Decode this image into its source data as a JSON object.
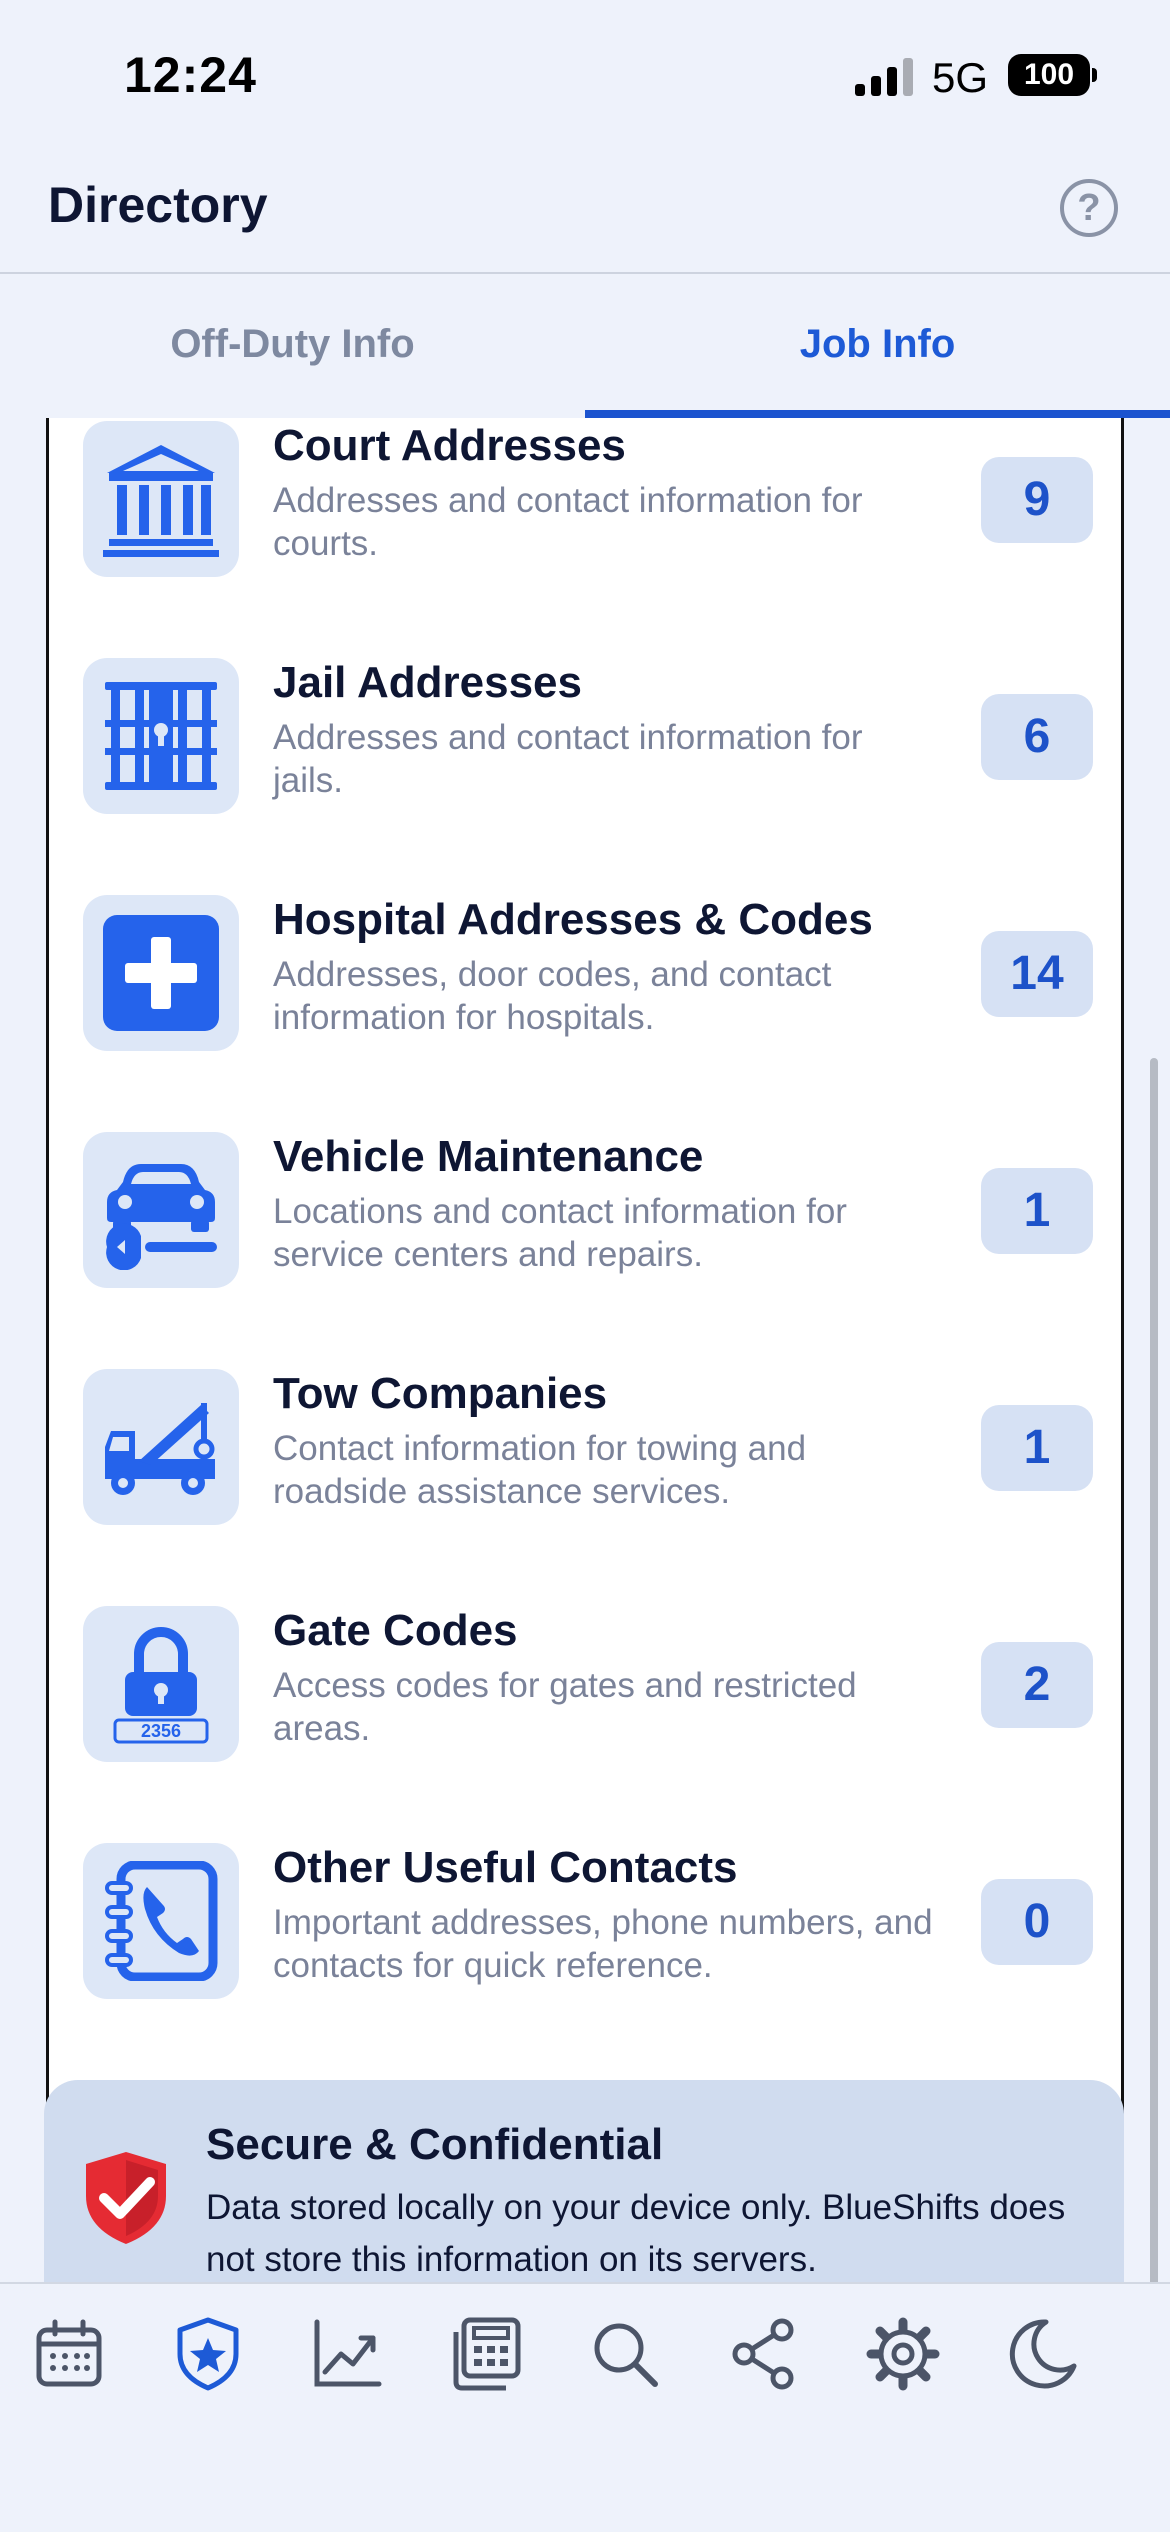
{
  "status_bar": {
    "time": "12:24",
    "network": "5G",
    "battery": "100"
  },
  "header": {
    "title": "Directory",
    "help_icon": "question-circle-icon",
    "help_glyph": "?"
  },
  "tabs": [
    {
      "label": "Off-Duty Info",
      "active": false
    },
    {
      "label": "Job Info",
      "active": true
    }
  ],
  "categories": [
    {
      "title": "Court Addresses",
      "description": "Addresses and contact information for courts.",
      "count": "9",
      "icon": "courthouse-icon"
    },
    {
      "title": "Jail Addresses",
      "description": "Addresses and contact information for jails.",
      "count": "6",
      "icon": "jail-bars-icon"
    },
    {
      "title": "Hospital Addresses & Codes",
      "description": "Addresses, door codes, and contact information for hospitals.",
      "count": "14",
      "icon": "hospital-cross-icon"
    },
    {
      "title": "Vehicle Maintenance",
      "description": "Locations and contact information for service centers and repairs.",
      "count": "1",
      "icon": "car-wrench-icon"
    },
    {
      "title": "Tow Companies",
      "description": "Contact information for towing and roadside assistance services.",
      "count": "1",
      "icon": "tow-truck-icon"
    },
    {
      "title": "Gate Codes",
      "description": "Access codes for gates and restricted areas.",
      "count": "2",
      "icon": "padlock-code-icon",
      "icon_text": "2356"
    },
    {
      "title": "Other Useful Contacts",
      "description": "Important addresses, phone numbers, and contacts for quick reference.",
      "count": "0",
      "icon": "phonebook-icon"
    }
  ],
  "secure_notice": {
    "title": "Secure & Confidential",
    "text": "Data stored locally on your device only. BlueShifts does not store this information on its servers.",
    "icon": "shield-check-icon"
  },
  "bottom_nav": [
    {
      "icon": "calendar-icon",
      "active": false
    },
    {
      "icon": "badge-star-icon",
      "active": true
    },
    {
      "icon": "chart-line-icon",
      "active": false
    },
    {
      "icon": "calculator-icon",
      "active": false
    },
    {
      "icon": "search-icon",
      "active": false
    },
    {
      "icon": "share-icon",
      "active": false
    },
    {
      "icon": "gear-icon",
      "active": false
    },
    {
      "icon": "moon-icon",
      "active": false
    }
  ],
  "colors": {
    "accent": "#1d5ad6",
    "icon_blue": "#2563eb",
    "icon_tile": "#dde7f7",
    "badge_bg": "#d6e1f4",
    "muted_text": "#7a8299",
    "page_bg": "#eef2fb",
    "shield_red": "#e52b33"
  }
}
